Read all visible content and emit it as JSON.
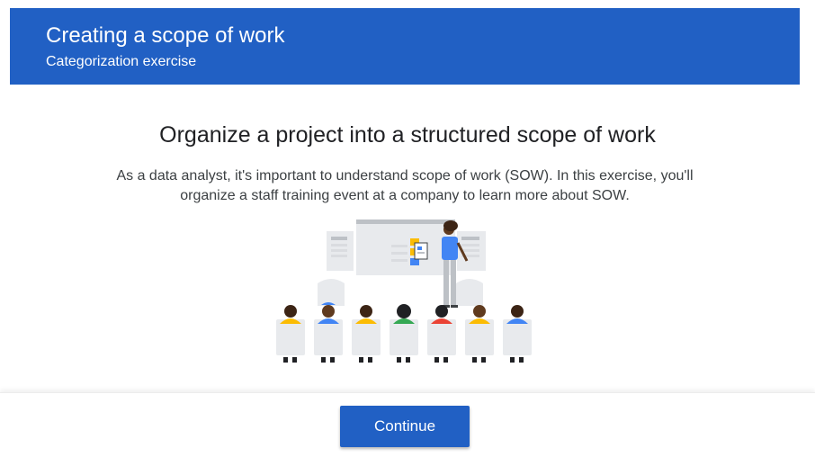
{
  "header": {
    "title": "Creating a scope of work",
    "subtitle": "Categorization exercise"
  },
  "main": {
    "heading": "Organize a project into a structured scope of work",
    "description": "As a data analyst, it's important to understand scope of work (SOW). In this exercise, you'll organize a staff training event at a company to learn more about SOW.",
    "illustration_icon": "presentation-illustration"
  },
  "footer": {
    "continue_label": "Continue"
  },
  "colors": {
    "brand": "#2160c4",
    "heading_text": "#202124",
    "body_text": "#3c4043"
  }
}
